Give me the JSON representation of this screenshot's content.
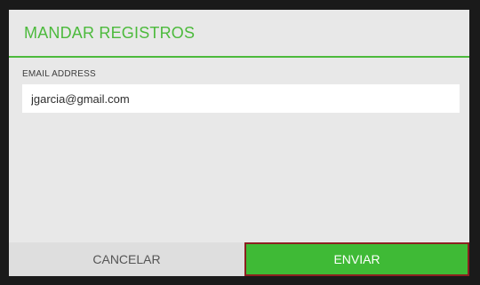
{
  "dialog": {
    "title": "MANDAR REGISTROS",
    "accent_color": "#4cba3c"
  },
  "email": {
    "label": "EMAIL ADDRESS",
    "value": "jgarcia@gmail.com"
  },
  "actions": {
    "cancel_label": "CANCELAR",
    "send_label": "ENVIAR",
    "send_color": "#3fba36",
    "send_border_color": "#8b2020"
  }
}
